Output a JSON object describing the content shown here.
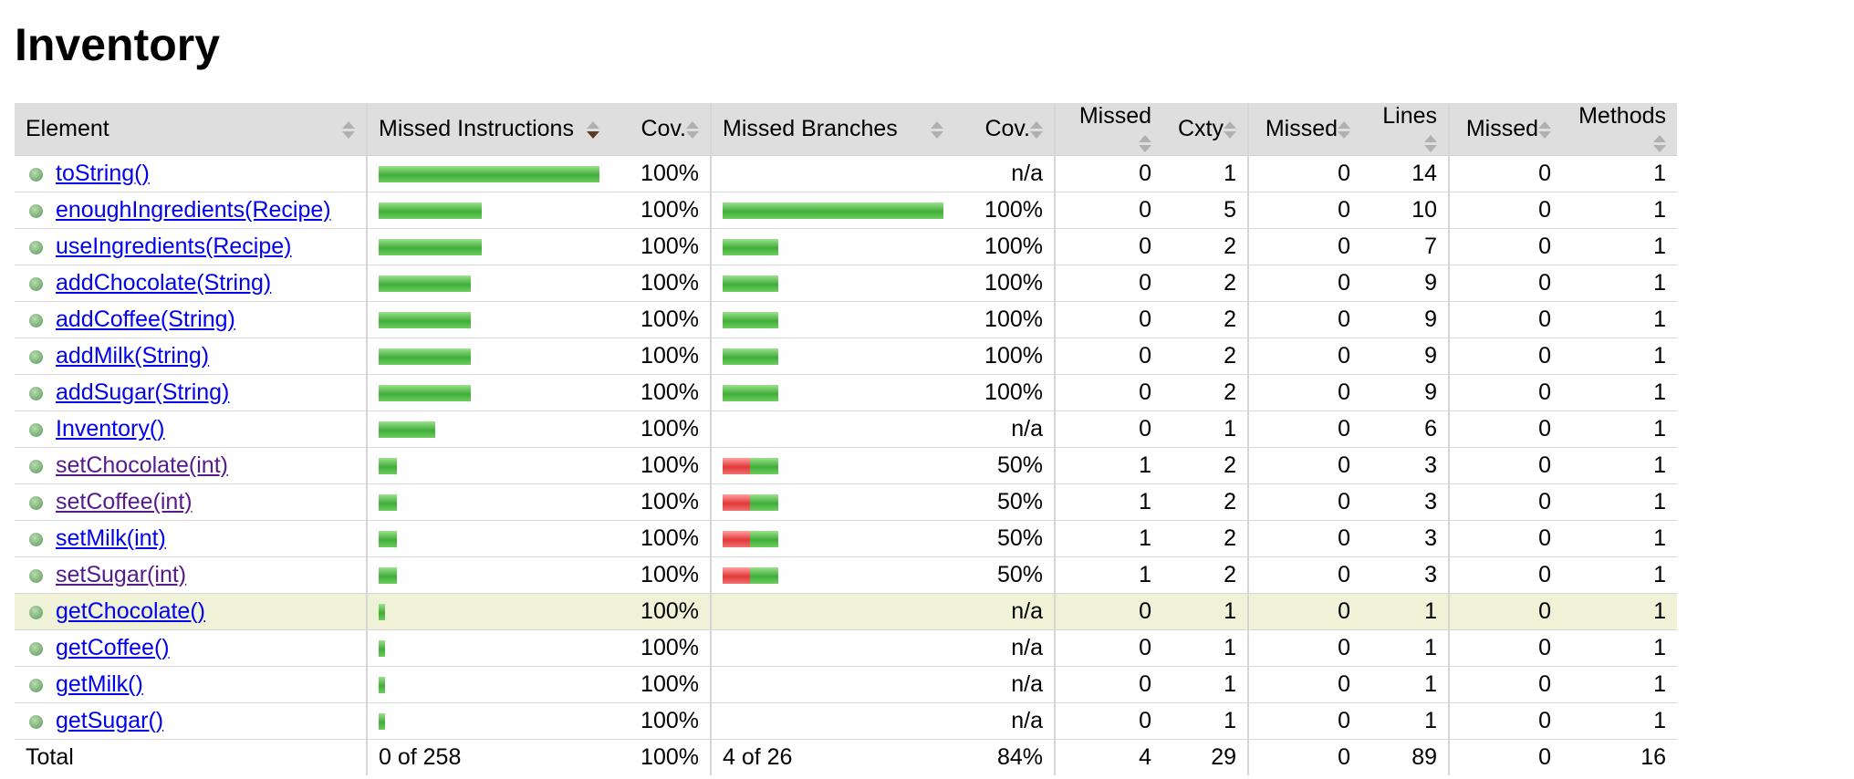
{
  "title": "Inventory",
  "headers": {
    "element": "Element",
    "missed_instructions": "Missed Instructions",
    "cov1": "Cov.",
    "missed_branches": "Missed Branches",
    "cov2": "Cov.",
    "missed_cxty": "Missed",
    "cxty": "Cxty",
    "missed_lines": "Missed",
    "lines": "Lines",
    "missed_methods": "Missed",
    "methods": "Methods"
  },
  "rows": [
    {
      "name": "toString()",
      "instr_cov": "100%",
      "instr_fill": 1.0,
      "branch_cov": "n/a",
      "branch_missed_frac": null,
      "branch_total_frac": null,
      "missed_cxty": "0",
      "cxty": "1",
      "missed_lines": "0",
      "lines": "14",
      "missed_methods": "0",
      "methods": "1",
      "visited": false
    },
    {
      "name": "enoughIngredients(Recipe)",
      "instr_cov": "100%",
      "instr_fill": 0.465,
      "branch_cov": "100%",
      "branch_missed_frac": 0.0,
      "branch_total_frac": 1.0,
      "missed_cxty": "0",
      "cxty": "5",
      "missed_lines": "0",
      "lines": "10",
      "missed_methods": "0",
      "methods": "1",
      "visited": false
    },
    {
      "name": "useIngredients(Recipe)",
      "instr_cov": "100%",
      "instr_fill": 0.465,
      "branch_cov": "100%",
      "branch_missed_frac": 0.0,
      "branch_total_frac": 0.25,
      "missed_cxty": "0",
      "cxty": "2",
      "missed_lines": "0",
      "lines": "7",
      "missed_methods": "0",
      "methods": "1",
      "visited": false
    },
    {
      "name": "addChocolate(String)",
      "instr_cov": "100%",
      "instr_fill": 0.418,
      "branch_cov": "100%",
      "branch_missed_frac": 0.0,
      "branch_total_frac": 0.25,
      "missed_cxty": "0",
      "cxty": "2",
      "missed_lines": "0",
      "lines": "9",
      "missed_methods": "0",
      "methods": "1",
      "visited": false
    },
    {
      "name": "addCoffee(String)",
      "instr_cov": "100%",
      "instr_fill": 0.418,
      "branch_cov": "100%",
      "branch_missed_frac": 0.0,
      "branch_total_frac": 0.25,
      "missed_cxty": "0",
      "cxty": "2",
      "missed_lines": "0",
      "lines": "9",
      "missed_methods": "0",
      "methods": "1",
      "visited": false
    },
    {
      "name": "addMilk(String)",
      "instr_cov": "100%",
      "instr_fill": 0.418,
      "branch_cov": "100%",
      "branch_missed_frac": 0.0,
      "branch_total_frac": 0.25,
      "missed_cxty": "0",
      "cxty": "2",
      "missed_lines": "0",
      "lines": "9",
      "missed_methods": "0",
      "methods": "1",
      "visited": false
    },
    {
      "name": "addSugar(String)",
      "instr_cov": "100%",
      "instr_fill": 0.418,
      "branch_cov": "100%",
      "branch_missed_frac": 0.0,
      "branch_total_frac": 0.25,
      "missed_cxty": "0",
      "cxty": "2",
      "missed_lines": "0",
      "lines": "9",
      "missed_methods": "0",
      "methods": "1",
      "visited": false
    },
    {
      "name": "Inventory()",
      "instr_cov": "100%",
      "instr_fill": 0.256,
      "branch_cov": "n/a",
      "branch_missed_frac": null,
      "branch_total_frac": null,
      "missed_cxty": "0",
      "cxty": "1",
      "missed_lines": "0",
      "lines": "6",
      "missed_methods": "0",
      "methods": "1",
      "visited": false
    },
    {
      "name": "setChocolate(int)",
      "instr_cov": "100%",
      "instr_fill": 0.081,
      "branch_cov": "50%",
      "branch_missed_frac": 0.125,
      "branch_total_frac": 0.25,
      "missed_cxty": "1",
      "cxty": "2",
      "missed_lines": "0",
      "lines": "3",
      "missed_methods": "0",
      "methods": "1",
      "visited": true
    },
    {
      "name": "setCoffee(int)",
      "instr_cov": "100%",
      "instr_fill": 0.081,
      "branch_cov": "50%",
      "branch_missed_frac": 0.125,
      "branch_total_frac": 0.25,
      "missed_cxty": "1",
      "cxty": "2",
      "missed_lines": "0",
      "lines": "3",
      "missed_methods": "0",
      "methods": "1",
      "visited": true
    },
    {
      "name": "setMilk(int)",
      "instr_cov": "100%",
      "instr_fill": 0.081,
      "branch_cov": "50%",
      "branch_missed_frac": 0.125,
      "branch_total_frac": 0.25,
      "missed_cxty": "1",
      "cxty": "2",
      "missed_lines": "0",
      "lines": "3",
      "missed_methods": "0",
      "methods": "1",
      "visited": false
    },
    {
      "name": "setSugar(int)",
      "instr_cov": "100%",
      "instr_fill": 0.081,
      "branch_cov": "50%",
      "branch_missed_frac": 0.125,
      "branch_total_frac": 0.25,
      "missed_cxty": "1",
      "cxty": "2",
      "missed_lines": "0",
      "lines": "3",
      "missed_methods": "0",
      "methods": "1",
      "visited": true
    },
    {
      "name": "getChocolate()",
      "instr_cov": "100%",
      "instr_fill": 0.03,
      "branch_cov": "n/a",
      "branch_missed_frac": null,
      "branch_total_frac": null,
      "missed_cxty": "0",
      "cxty": "1",
      "missed_lines": "0",
      "lines": "1",
      "missed_methods": "0",
      "methods": "1",
      "visited": false,
      "highlight": true
    },
    {
      "name": "getCoffee()",
      "instr_cov": "100%",
      "instr_fill": 0.03,
      "branch_cov": "n/a",
      "branch_missed_frac": null,
      "branch_total_frac": null,
      "missed_cxty": "0",
      "cxty": "1",
      "missed_lines": "0",
      "lines": "1",
      "missed_methods": "0",
      "methods": "1",
      "visited": false
    },
    {
      "name": "getMilk()",
      "instr_cov": "100%",
      "instr_fill": 0.03,
      "branch_cov": "n/a",
      "branch_missed_frac": null,
      "branch_total_frac": null,
      "missed_cxty": "0",
      "cxty": "1",
      "missed_lines": "0",
      "lines": "1",
      "missed_methods": "0",
      "methods": "1",
      "visited": false
    },
    {
      "name": "getSugar()",
      "instr_cov": "100%",
      "instr_fill": 0.03,
      "branch_cov": "n/a",
      "branch_missed_frac": null,
      "branch_total_frac": null,
      "missed_cxty": "0",
      "cxty": "1",
      "missed_lines": "0",
      "lines": "1",
      "missed_methods": "0",
      "methods": "1",
      "visited": false
    }
  ],
  "total": {
    "label": "Total",
    "missed_instructions": "0 of 258",
    "instr_cov": "100%",
    "missed_branches": "4 of 26",
    "branch_cov": "84%",
    "missed_cxty": "4",
    "cxty": "29",
    "missed_lines": "0",
    "lines": "89",
    "missed_methods": "0",
    "methods": "16"
  },
  "colors": {
    "covered": "#4cb443",
    "missed": "#e23a3a",
    "link": "#0000ee",
    "visited_link": "#551a8b",
    "highlight_row": "#f0f2d8",
    "header_bg": "#dedede"
  }
}
